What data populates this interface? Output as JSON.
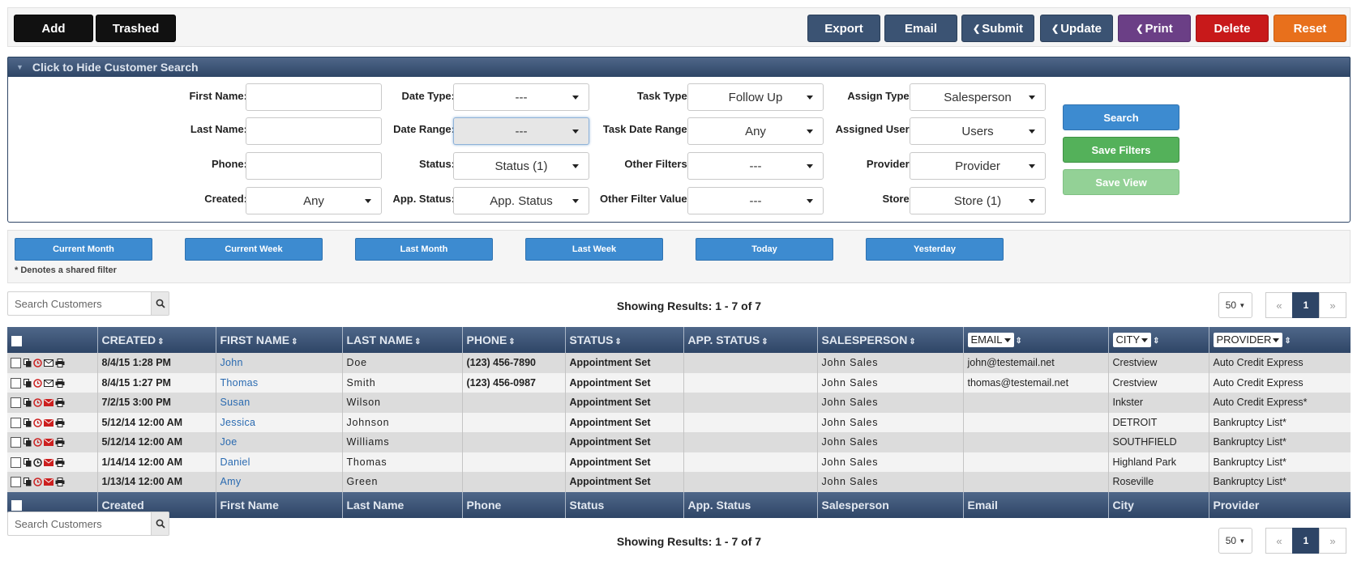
{
  "toolbar": {
    "add": "Add",
    "trashed": "Trashed",
    "export": "Export",
    "email": "Email",
    "submit": "Submit",
    "update": "Update",
    "print": "Print",
    "delete": "Delete",
    "reset": "Reset"
  },
  "search_panel": {
    "toggle_label": "Click to Hide Customer Search",
    "first_name_label": "First Name:",
    "last_name_label": "Last Name:",
    "phone_label": "Phone:",
    "created_label": "Created:",
    "created_value": "Any",
    "date_type_label": "Date Type:",
    "date_type_value": "---",
    "date_range_label": "Date Range:",
    "date_range_value": "---",
    "status_label": "Status:",
    "status_value": "Status (1)",
    "app_status_label": "App. Status:",
    "app_status_value": "App. Status",
    "task_type_label": "Task Type:",
    "task_type_value": "Follow Up",
    "task_date_range_label": "Task Date Range:",
    "task_date_range_value": "Any",
    "other_filters_label": "Other Filters:",
    "other_filters_value": "---",
    "other_filter_value_label": "Other Filter Value:",
    "other_filter_value_value": "---",
    "assign_type_label": "Assign Type:",
    "assign_type_value": "Salesperson",
    "assigned_user_label": "Assigned User:",
    "assigned_user_value": "Users",
    "provider_label": "Provider:",
    "provider_value": "Provider",
    "store_label": "Store:",
    "store_value": "Store (1)",
    "search_button": "Search",
    "save_filters_button": "Save Filters",
    "save_view_button": "Save View"
  },
  "quick_ranges": {
    "items": [
      "Current Month",
      "Current Week",
      "Last Month",
      "Last Week",
      "Today",
      "Yesterday"
    ],
    "note": "* Denotes a shared filter"
  },
  "list_controls": {
    "search_placeholder": "Search Customers",
    "results_text": "Showing Results: 1 - 7 of 7",
    "page_size": "50",
    "prev": "«",
    "current_page": "1",
    "next": "»"
  },
  "table": {
    "headers": [
      "CREATED",
      "FIRST NAME",
      "LAST NAME",
      "PHONE",
      "STATUS",
      "APP. STATUS",
      "SALESPERSON",
      "EMAIL",
      "CITY",
      "PROVIDER"
    ],
    "footers": [
      "Created",
      "First Name",
      "Last Name",
      "Phone",
      "Status",
      "App. Status",
      "Salesperson",
      "Email",
      "City",
      "Provider"
    ],
    "rows": [
      {
        "created": "8/4/15 1:28 PM",
        "first": "John",
        "last": "Doe",
        "phone": "(123) 456-7890",
        "status": "Appointment Set",
        "app_status": "",
        "salesperson": "John Sales",
        "email": "john@testemail.net",
        "city": "Crestview",
        "provider": "Auto Credit Express",
        "mail_color": "#222222",
        "time_color": "#cc1f1f"
      },
      {
        "created": "8/4/15 1:27 PM",
        "first": "Thomas",
        "last": "Smith",
        "phone": "(123) 456-0987",
        "status": "Appointment Set",
        "app_status": "",
        "salesperson": "John Sales",
        "email": "thomas@testemail.net",
        "city": "Crestview",
        "provider": "Auto Credit Express",
        "mail_color": "#222222",
        "time_color": "#cc1f1f"
      },
      {
        "created": "7/2/15 3:00 PM",
        "first": "Susan",
        "last": "Wilson",
        "phone": "",
        "status": "Appointment Set",
        "app_status": "",
        "salesperson": "John Sales",
        "email": "",
        "city": "Inkster",
        "provider": "Auto Credit Express*",
        "mail_color": "#cc1f1f",
        "time_color": "#cc1f1f"
      },
      {
        "created": "5/12/14 12:00 AM",
        "first": "Jessica",
        "last": "Johnson",
        "phone": "",
        "status": "Appointment Set",
        "app_status": "",
        "salesperson": "John Sales",
        "email": "",
        "city": "DETROIT",
        "provider": "Bankruptcy List*",
        "mail_color": "#cc1f1f",
        "time_color": "#cc1f1f"
      },
      {
        "created": "5/12/14 12:00 AM",
        "first": "Joe",
        "last": "Williams",
        "phone": "",
        "status": "Appointment Set",
        "app_status": "",
        "salesperson": "John Sales",
        "email": "",
        "city": "SOUTHFIELD",
        "provider": "Bankruptcy List*",
        "mail_color": "#cc1f1f",
        "time_color": "#cc1f1f"
      },
      {
        "created": "1/14/14 12:00 AM",
        "first": "Daniel",
        "last": "Thomas",
        "phone": "",
        "status": "Appointment Set",
        "app_status": "",
        "salesperson": "John Sales",
        "email": "",
        "city": "Highland Park",
        "provider": "Bankruptcy List*",
        "mail_color": "#cc1f1f",
        "time_color": "#222222"
      },
      {
        "created": "1/13/14 12:00 AM",
        "first": "Amy",
        "last": "Green",
        "phone": "",
        "status": "Appointment Set",
        "app_status": "",
        "salesperson": "John Sales",
        "email": "",
        "city": "Roseville",
        "provider": "Bankruptcy List*",
        "mail_color": "#cc1f1f",
        "time_color": "#cc1f1f"
      }
    ]
  },
  "colors": {
    "navy": "#2e4566",
    "blue_button": "#3d8bd0",
    "link": "#2a6ab0"
  }
}
